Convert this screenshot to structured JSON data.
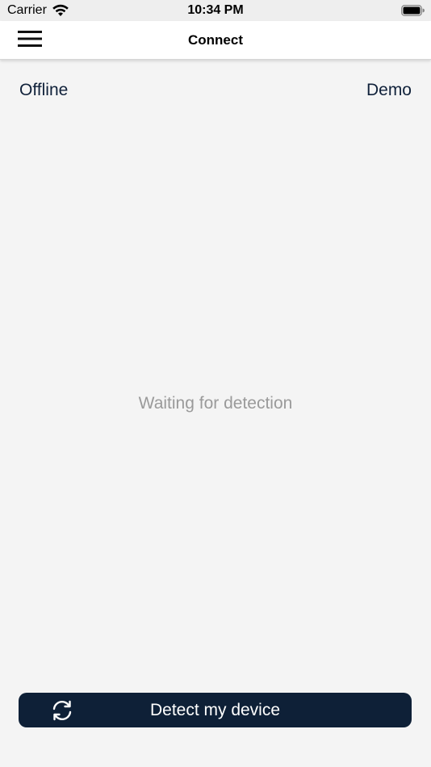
{
  "status_bar": {
    "carrier": "Carrier",
    "time": "10:34 PM",
    "icons": [
      "wifi-icon",
      "battery-icon"
    ]
  },
  "nav": {
    "title": "Connect",
    "menu_icon": "hamburger-menu-icon"
  },
  "top_row": {
    "left_label": "Offline",
    "right_label": "Demo"
  },
  "main": {
    "status_text": "Waiting for detection"
  },
  "footer": {
    "button_label": "Detect my device",
    "button_icon": "refresh-icon",
    "button_color": "#0e2037"
  }
}
